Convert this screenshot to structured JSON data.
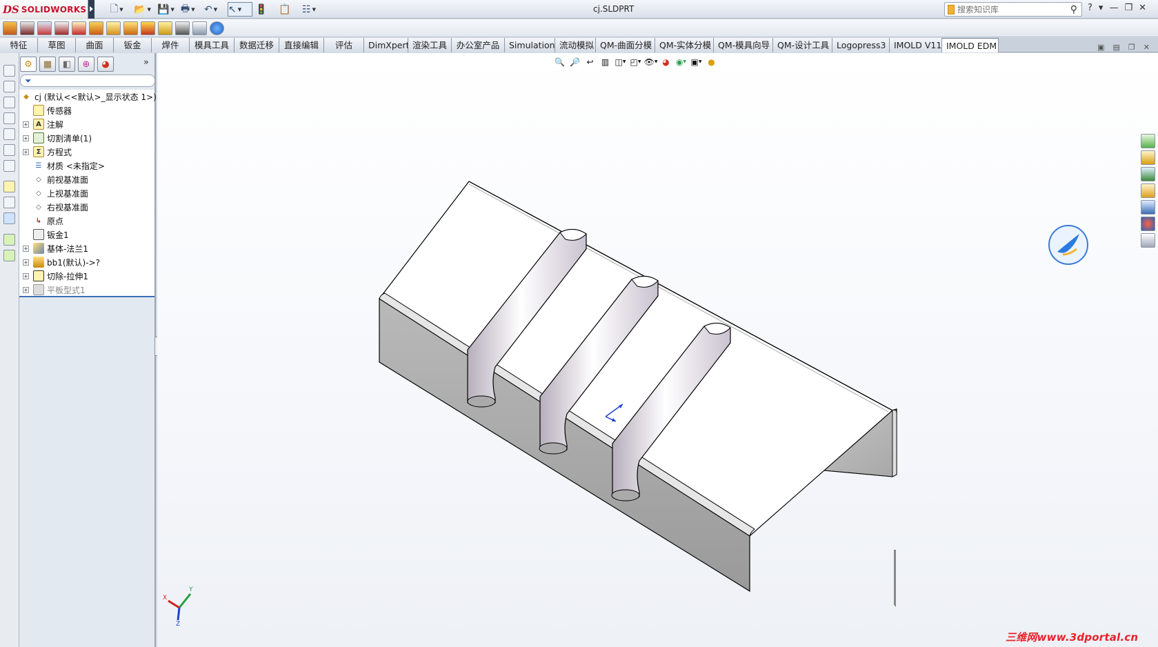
{
  "app": {
    "logo_ds": "DS",
    "logo_text": "SOLIDWORKS",
    "window_title": "cj.SLDPRT",
    "search_placeholder": "搜索知识库",
    "window_controls": [
      "?",
      "▾",
      "—",
      "❐",
      "✕"
    ]
  },
  "quick_toolbar": [
    {
      "icon": "new-document-icon",
      "glyph": "🗋"
    },
    {
      "icon": "open-folder-icon",
      "glyph": "📂"
    },
    {
      "icon": "save-icon",
      "glyph": "💾"
    },
    {
      "icon": "print-icon",
      "glyph": "🖶"
    },
    {
      "icon": "undo-icon",
      "glyph": "↶"
    },
    {
      "icon": "select-icon",
      "glyph": "↖"
    },
    {
      "icon": "rebuild-icon",
      "glyph": "🚦"
    },
    {
      "icon": "file-properties-icon",
      "glyph": "📋"
    },
    {
      "icon": "options-icon",
      "glyph": "☷"
    }
  ],
  "tabs": [
    "特征",
    "草图",
    "曲面",
    "钣金",
    "焊件",
    "模具工具",
    "数据迁移",
    "直接编辑",
    "评估",
    "DimXpert",
    "渲染工具",
    "办公室产品",
    "Simulation",
    "流动模拟",
    "QM-曲面分模",
    "QM-实体分模",
    "QM-模具向导",
    "QM-设计工具",
    "Logopress3",
    "IMOLD V11",
    "IMOLD EDM"
  ],
  "active_tab": "IMOLD EDM",
  "feature_tree": {
    "filter_icon": "filter-icon",
    "more": "»",
    "items": [
      {
        "label": "cj  (默认<<默认>_显示状态 1>)",
        "icon": "part-icon",
        "expander": false,
        "level": 0
      },
      {
        "label": "传感器",
        "icon": "sensor-icon",
        "expander": false,
        "level": 1
      },
      {
        "label": "注解",
        "icon": "annotation-icon",
        "expander": true,
        "level": 1
      },
      {
        "label": "切割清单(1)",
        "icon": "cut-list-icon",
        "expander": true,
        "level": 1
      },
      {
        "label": "方程式",
        "icon": "equation-icon",
        "expander": true,
        "level": 1
      },
      {
        "label": "材质 <未指定>",
        "icon": "material-icon",
        "expander": false,
        "level": 1
      },
      {
        "label": "前视基准面",
        "icon": "plane-icon",
        "expander": false,
        "level": 1
      },
      {
        "label": "上视基准面",
        "icon": "plane-icon",
        "expander": false,
        "level": 1
      },
      {
        "label": "右视基准面",
        "icon": "plane-icon",
        "expander": false,
        "level": 1
      },
      {
        "label": "原点",
        "icon": "origin-icon",
        "expander": false,
        "level": 1
      },
      {
        "label": "钣金1",
        "icon": "sheet-metal-icon",
        "expander": false,
        "level": 1
      },
      {
        "label": "基体-法兰1",
        "icon": "base-flange-icon",
        "expander": true,
        "level": 1
      },
      {
        "label": "bb1(默认)->?",
        "icon": "forming-tool-icon",
        "expander": true,
        "level": 1
      },
      {
        "label": "切除-拉伸1",
        "icon": "cut-extrude-icon",
        "expander": true,
        "level": 1
      },
      {
        "label": "平板型式1",
        "icon": "flat-pattern-icon",
        "expander": true,
        "level": 1,
        "suppressed": true
      }
    ]
  },
  "view_tools": [
    "zoom-to-fit-icon",
    "zoom-area-icon",
    "previous-view-icon",
    "section-view-icon",
    "view-orientation-icon",
    "display-style-icon",
    "hide-show-icon",
    "appearance-icon",
    "scene-icon",
    "view-settings-icon",
    "realview-icon"
  ],
  "triad": {
    "x": "X",
    "y": "Y",
    "z": "Z"
  },
  "watermark": "三维网www.3dportal.cn",
  "colors": {
    "accent": "#3d6fb5",
    "brand": "#c8102e",
    "watermark": "#e8212b",
    "model_top": "#ffffff",
    "model_side": "#a9a9a9"
  }
}
